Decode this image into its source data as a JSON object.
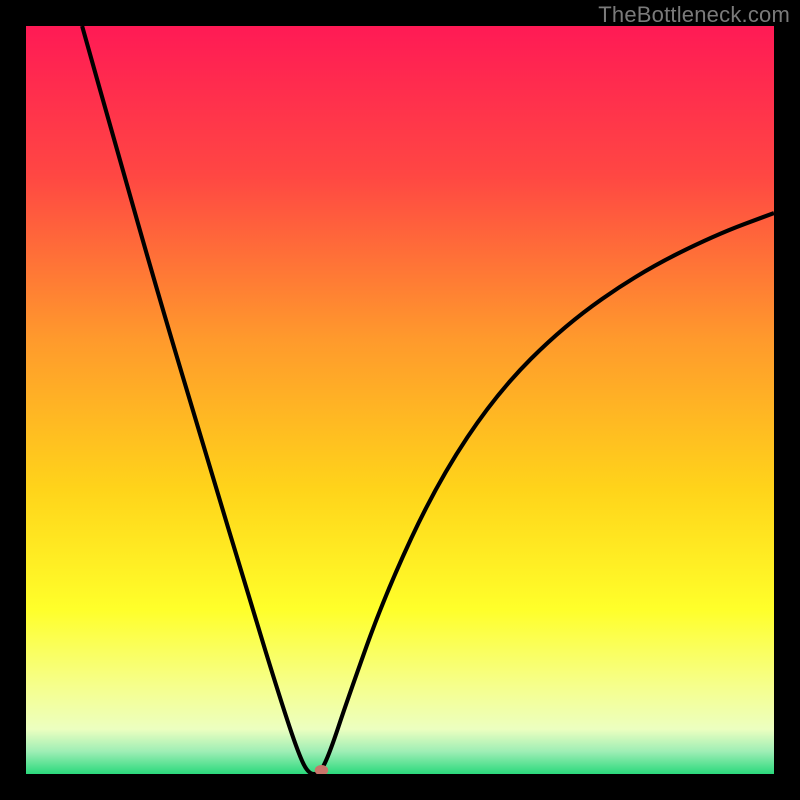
{
  "watermark": "TheBottleneck.com",
  "chart_data": {
    "type": "line",
    "title": "",
    "xlabel": "",
    "ylabel": "",
    "xlim": [
      0,
      100
    ],
    "ylim": [
      0,
      100
    ],
    "gradient_stops": [
      {
        "offset": 0,
        "color": "#ff1a55"
      },
      {
        "offset": 20,
        "color": "#ff4743"
      },
      {
        "offset": 42,
        "color": "#ff9a2c"
      },
      {
        "offset": 62,
        "color": "#ffd41a"
      },
      {
        "offset": 78,
        "color": "#ffff2a"
      },
      {
        "offset": 88,
        "color": "#f6ff8a"
      },
      {
        "offset": 94,
        "color": "#ecffc0"
      },
      {
        "offset": 97,
        "color": "#9eeeb5"
      },
      {
        "offset": 100,
        "color": "#2bd97c"
      }
    ],
    "series": [
      {
        "name": "bottleneck-curve",
        "color": "#000000",
        "points": [
          {
            "x": 7.5,
            "y": 100
          },
          {
            "x": 12,
            "y": 84
          },
          {
            "x": 18,
            "y": 63
          },
          {
            "x": 24,
            "y": 43
          },
          {
            "x": 30,
            "y": 23
          },
          {
            "x": 34,
            "y": 10
          },
          {
            "x": 36.5,
            "y": 2.5
          },
          {
            "x": 37.8,
            "y": 0.0
          },
          {
            "x": 39.2,
            "y": 0.0
          },
          {
            "x": 40.5,
            "y": 2.5
          },
          {
            "x": 43,
            "y": 10
          },
          {
            "x": 48,
            "y": 24
          },
          {
            "x": 55,
            "y": 39
          },
          {
            "x": 63,
            "y": 51
          },
          {
            "x": 72,
            "y": 60
          },
          {
            "x": 82,
            "y": 67
          },
          {
            "x": 92,
            "y": 72
          },
          {
            "x": 100,
            "y": 75
          }
        ]
      }
    ],
    "marker": {
      "x": 39.5,
      "y": 0.5,
      "color": "#c9746a"
    }
  }
}
